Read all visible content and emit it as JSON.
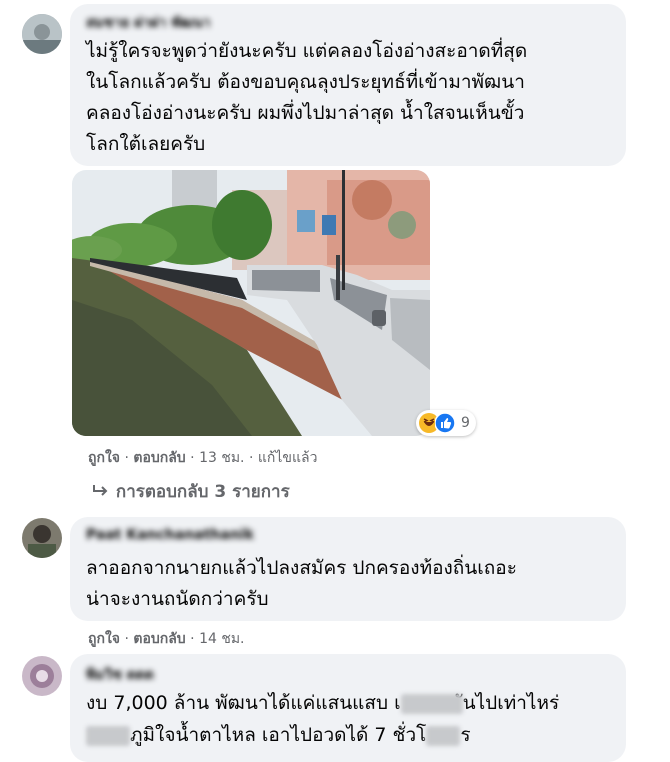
{
  "comments": [
    {
      "name": "สมชาย ผ่าผ่า พัฒนา",
      "text_lines": [
        "ไม่รู้ใครจะพูดว่ายังนะครับ แต่คลองโอ่งอ่างสะอาดที่สุด",
        "ในโลกแล้วครับ ต้องขอบคุณลุงประยุทธ์ที่เข้ามาพัฒนา",
        "คลองโอ่งอ่างนะครับ ผมพึ่งไปมาล่าสุด น้ำใสจนเห็นขั้ว",
        "โลกใต้เลยครับ"
      ],
      "like": "ถูกใจ",
      "reply": "ตอบกลับ",
      "time": "13 ชม.",
      "edited": "แก้ไขแล้ว",
      "reaction_count": "9",
      "replies_label": "การตอบกลับ 3 รายการ"
    },
    {
      "name": "Paat Kanchanathanik",
      "text_lines": [
        "ลาออกจากนายกแล้วไปลงสมัคร ปกครองท้องถิ่นเถอะ",
        "น่าจะงานถนัดกว่าครับ"
      ],
      "like": "ถูกใจ",
      "reply": "ตอบกลับ",
      "time": "14 ชม."
    },
    {
      "name": "พิมวิช ดดด",
      "line1_a": "งบ 7,000 ล้าน พัฒนาได้แค่แสนแสบ เ",
      "line1_b": "ันไปเท่าไหร่",
      "line2_a": "ภูมิใจน้ำตาไหล เอาไปอวดได้ 7 ชั่วโ",
      "line2_b": "ร"
    }
  ],
  "colors": {
    "bubble": "#f0f2f5",
    "meta_text": "#65676b",
    "like_blue": "#1877f2",
    "haha_yellow": "#f7b928"
  }
}
